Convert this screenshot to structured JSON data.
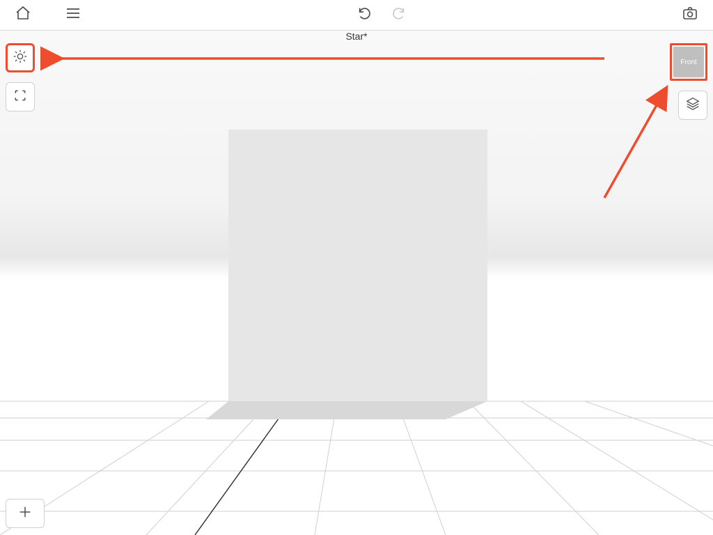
{
  "document": {
    "title": "Star*"
  },
  "viewcube": {
    "face_label": "Front"
  },
  "colors": {
    "callout": "#ee4d2d",
    "cube_fill": "#e6e6e6",
    "cube_shadow": "#d8d8d8",
    "grid_line": "#cfcfcf",
    "grid_line_dark": "#2b2b2b"
  },
  "icons": {
    "home": "home-icon",
    "menu": "menu-icon",
    "undo": "undo-icon",
    "redo": "redo-icon",
    "camera": "camera-icon",
    "sun": "sun-icon",
    "selection": "selection-box-icon",
    "layers": "layers-icon",
    "add": "add-icon"
  }
}
